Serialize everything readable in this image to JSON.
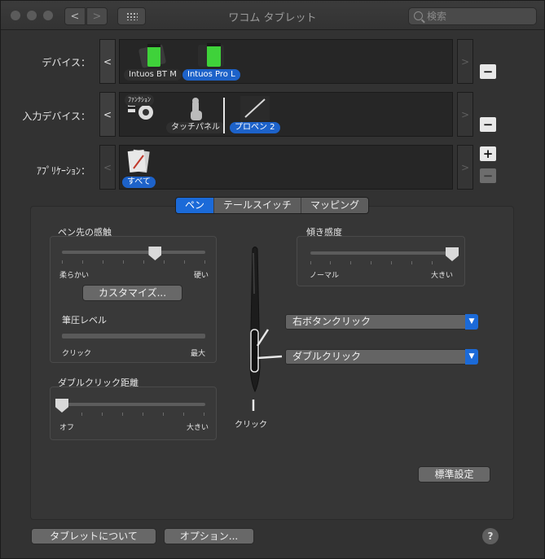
{
  "window": {
    "title": "ワコム タブレット"
  },
  "toolbar": {
    "back_glyph": "<",
    "forward_glyph": ">",
    "search_placeholder": "検索"
  },
  "rows": {
    "devices": {
      "label": "デバイス：",
      "left_arrow": "<",
      "right_arrow": ">",
      "minus": "−",
      "items": [
        {
          "label": "Intuos BT M",
          "selected": false
        },
        {
          "label": "Intuos Pro L",
          "selected": true
        }
      ]
    },
    "inputs": {
      "label": "入力デバイス：",
      "left_arrow": "<",
      "right_arrow": ">",
      "minus": "−",
      "items": [
        {
          "label": "ﾌｧﾝｸｼｮﾝ",
          "selected": false
        },
        {
          "label": "タッチパネル",
          "selected": false
        },
        {
          "label": "プロペン 2",
          "selected": true
        }
      ]
    },
    "apps": {
      "label": "ｱﾌﾟﾘｹｰｼｮﾝ：",
      "left_arrow": "<",
      "right_arrow": ">",
      "plus": "+",
      "minus": "−",
      "items": [
        {
          "label": "すべて",
          "selected": true
        }
      ]
    }
  },
  "tabs": [
    {
      "label": "ペン",
      "selected": true
    },
    {
      "label": "テールスイッチ",
      "selected": false
    },
    {
      "label": "マッピング",
      "selected": false
    }
  ],
  "pen": {
    "tip_feel": {
      "title": "ペン先の感触",
      "min_label": "柔らかい",
      "max_label": "硬い",
      "value": 0.65,
      "customize_label": "カスタマイズ...",
      "pressure_title": "筆圧レベル",
      "pressure_min": "クリック",
      "pressure_max": "最大"
    },
    "double_click": {
      "title": "ダブルクリック距離",
      "min_label": "オフ",
      "max_label": "大きい",
      "value": 0.0
    },
    "tilt": {
      "title": "傾き感度",
      "min_label": "ノーマル",
      "max_label": "大きい",
      "value": 1.0
    },
    "upper_button": "右ボタンクリック",
    "lower_button": "ダブルクリック",
    "tip_label": "クリック",
    "default_label": "標準設定"
  },
  "footer": {
    "about_label": "タブレットについて",
    "options_label": "オプション...",
    "help_label": "?"
  },
  "colors": {
    "accent": "#1b6ad8",
    "background": "#323232"
  }
}
